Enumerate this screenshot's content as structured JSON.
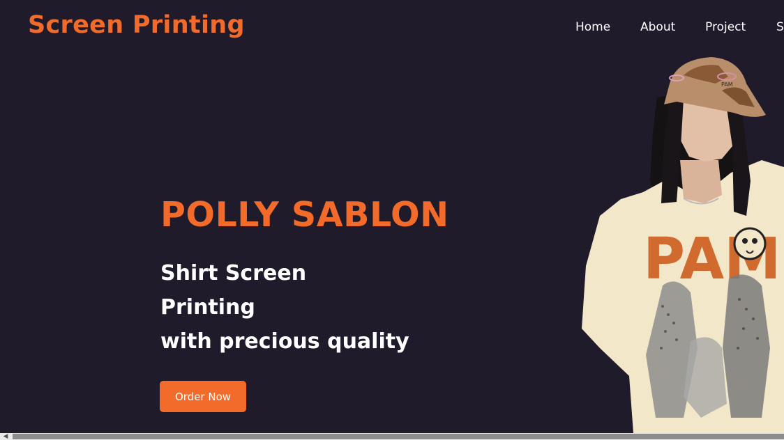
{
  "header": {
    "logo": "Screen Printing",
    "nav": [
      "Home",
      "About",
      "Project",
      "S"
    ]
  },
  "hero": {
    "title": "POLLY SABLON",
    "tagline": [
      "Shirt Screen",
      "Printing",
      "with precious quality"
    ],
    "cta_label": "Order Now",
    "image": {
      "subject": "model-wearing-cap-and-printed-tshirt",
      "cap_text": "PAM",
      "shirt_print": "PAM"
    }
  },
  "colors": {
    "background": "#1f1b2b",
    "accent": "#f26b2a",
    "text": "#ffffff"
  }
}
